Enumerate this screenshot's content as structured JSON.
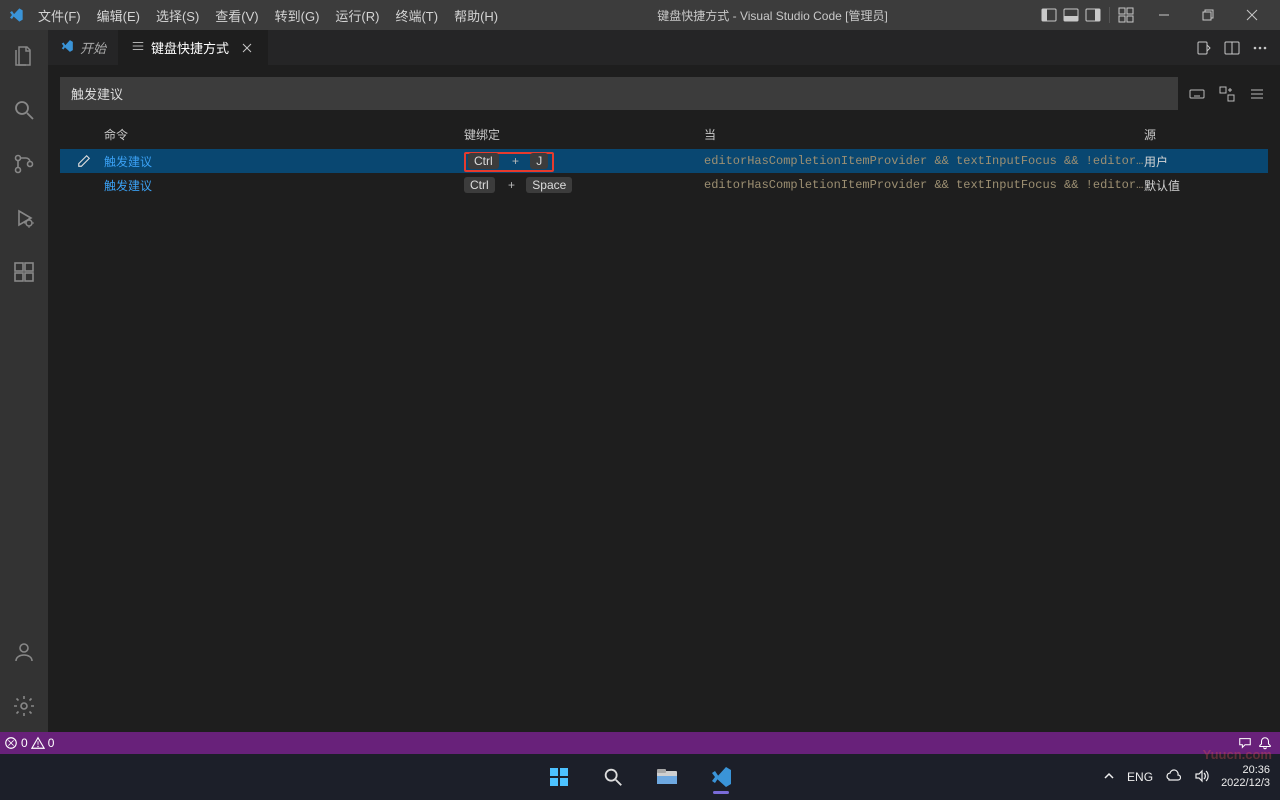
{
  "window": {
    "title": "键盘快捷方式 - Visual Studio Code [管理员]"
  },
  "menu": {
    "items": [
      "文件(F)",
      "编辑(E)",
      "选择(S)",
      "查看(V)",
      "转到(G)",
      "运行(R)",
      "终端(T)",
      "帮助(H)"
    ]
  },
  "tabs": {
    "start": {
      "label": "开始"
    },
    "keybindings": {
      "label": "键盘快捷方式"
    }
  },
  "keybindings": {
    "search_value": "触发建议",
    "columns": {
      "command": "命令",
      "key": "键绑定",
      "when": "当",
      "source": "源"
    },
    "rows": [
      {
        "command": "触发建议",
        "key_parts": [
          "Ctrl",
          "+",
          "J"
        ],
        "when": "editorHasCompletionItemProvider && textInputFocus && !editorReadon…",
        "source": "用户",
        "selected": true,
        "highlighted": true
      },
      {
        "command": "触发建议",
        "key_parts": [
          "Ctrl",
          "+",
          "Space"
        ],
        "when": "editorHasCompletionItemProvider && textInputFocus && !editorReadon…",
        "source": "默认值",
        "selected": false,
        "highlighted": false
      }
    ]
  },
  "statusbar": {
    "errors": "0",
    "warnings": "0"
  },
  "taskbar": {
    "lang": "ENG",
    "time": "20:36",
    "date": "2022/12/3"
  },
  "watermark": "Yuucn.com"
}
